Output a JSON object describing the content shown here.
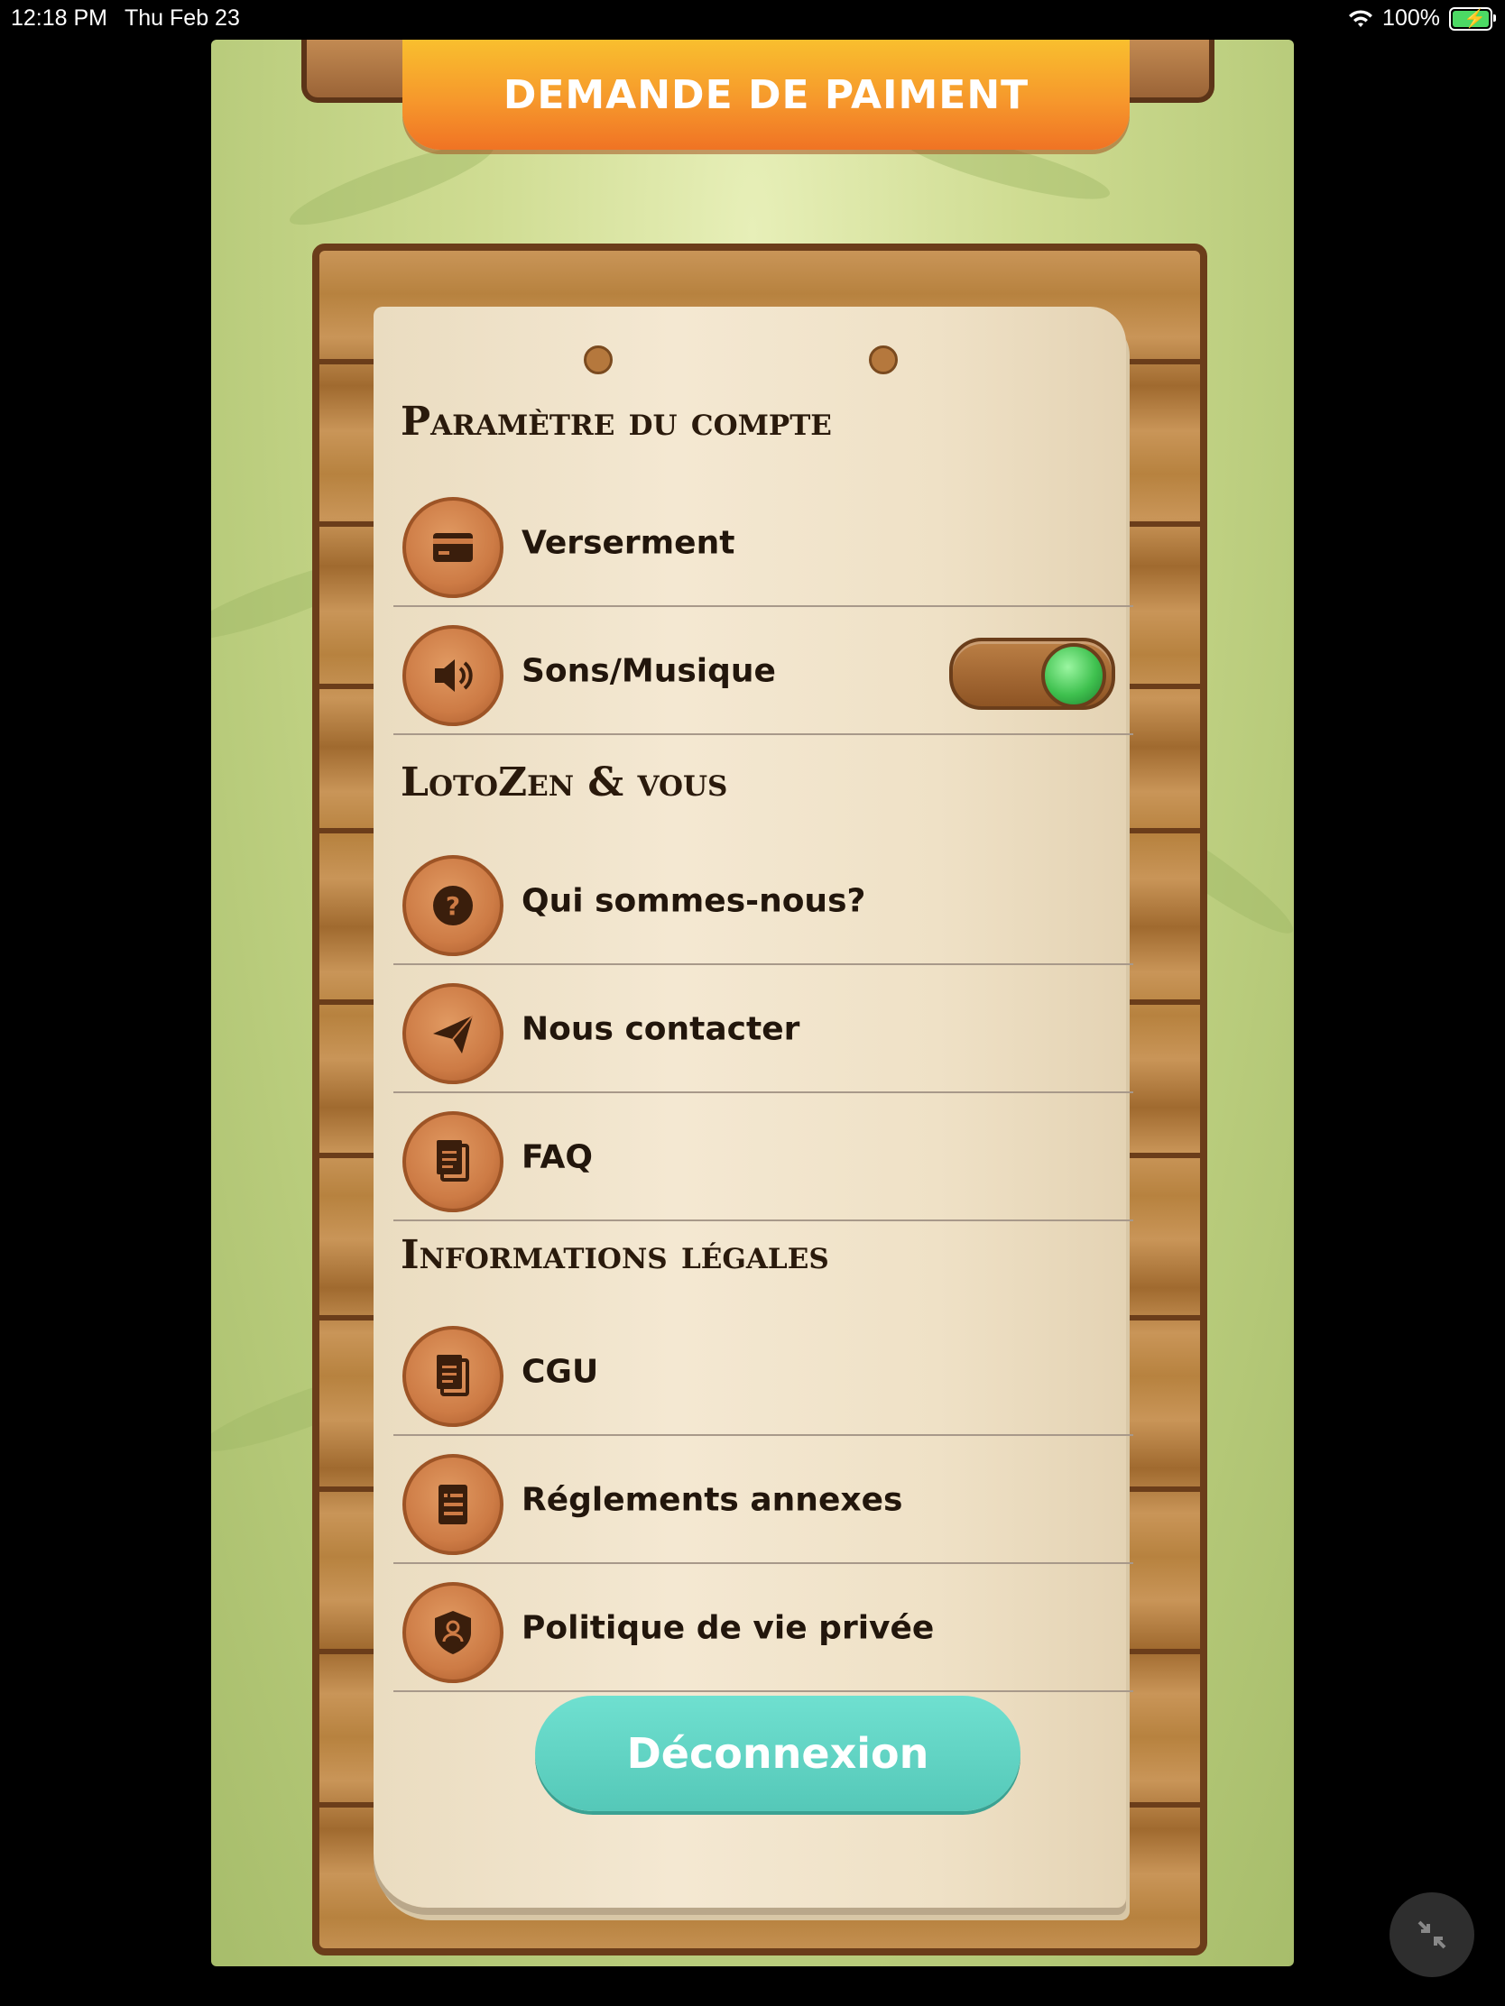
{
  "status_bar": {
    "time": "12:18 PM",
    "date": "Thu Feb 23",
    "battery": "100%"
  },
  "header": {
    "title": "DEMANDE DE PAIMENT"
  },
  "sections": [
    {
      "title": "Paramètre du compte",
      "items": [
        {
          "label": "Verserment",
          "icon": "card-icon"
        },
        {
          "label": "Sons/Musique",
          "icon": "speaker-icon",
          "toggle": true
        }
      ]
    },
    {
      "title": "LotoZen & vous",
      "items": [
        {
          "label": "Qui sommes-nous?",
          "icon": "question-icon"
        },
        {
          "label": "Nous contacter",
          "icon": "paper-plane-icon"
        },
        {
          "label": "FAQ",
          "icon": "documents-icon"
        }
      ]
    },
    {
      "title": "Informations légales",
      "items": [
        {
          "label": "CGU",
          "icon": "documents-icon"
        },
        {
          "label": "Réglements annexes",
          "icon": "list-document-icon"
        },
        {
          "label": "Politique de vie privée",
          "icon": "shield-user-icon"
        }
      ]
    }
  ],
  "logout": {
    "label": "Déconnexion"
  },
  "colors": {
    "header_orange": "#f6982c",
    "logout_teal": "#5fd1c2",
    "badge_copper": "#cd7b45",
    "toggle_green": "#3fc14f"
  }
}
